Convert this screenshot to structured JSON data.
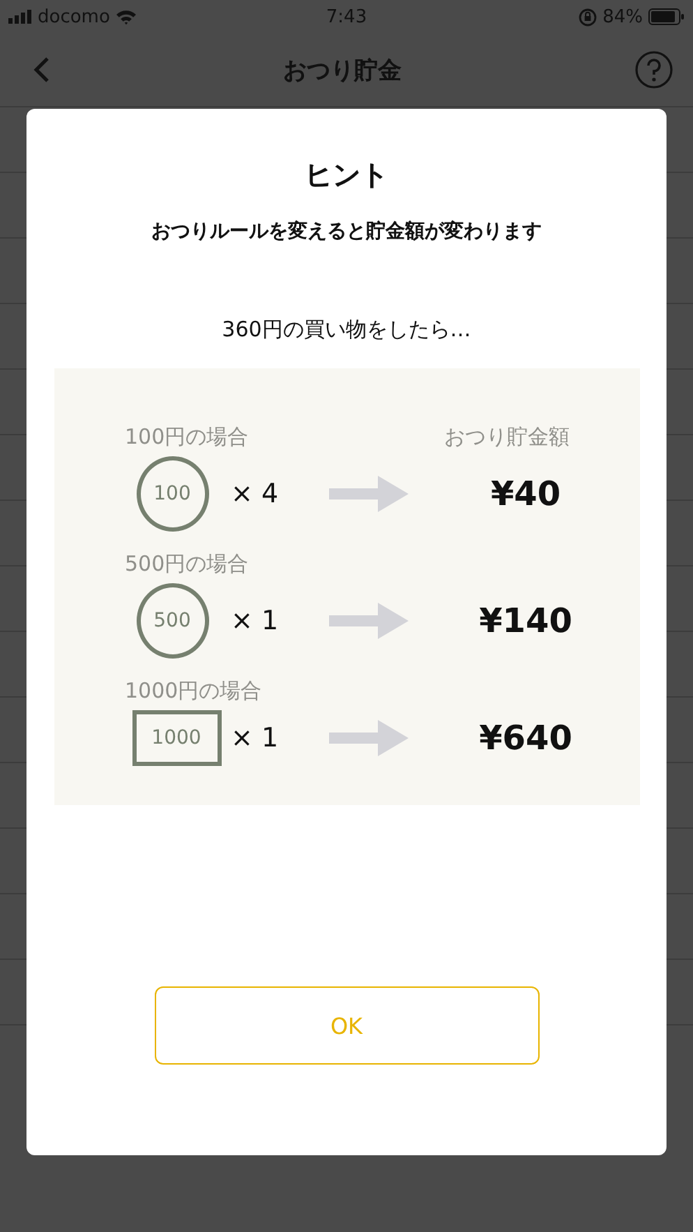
{
  "status_bar": {
    "carrier": "docomo",
    "time": "7:43",
    "battery": "84%"
  },
  "nav_bar": {
    "title": "おつり貯金"
  },
  "dialog": {
    "title": "ヒント",
    "subtitle": "おつりルールを変えると貯金額が変わります",
    "example": "360円の買い物をしたら…",
    "result_header": "おつり貯金額",
    "cases": [
      {
        "label": "100円の場合",
        "kind": "coin",
        "money": "100",
        "multiplier": "× 4",
        "amount": "¥40"
      },
      {
        "label": "500円の場合",
        "kind": "coin",
        "money": "500",
        "multiplier": "× 1",
        "amount": "¥140"
      },
      {
        "label": "1000円の場合",
        "kind": "bill",
        "money": "1000",
        "multiplier": "× 1",
        "amount": "¥640"
      }
    ],
    "button": "OK"
  }
}
